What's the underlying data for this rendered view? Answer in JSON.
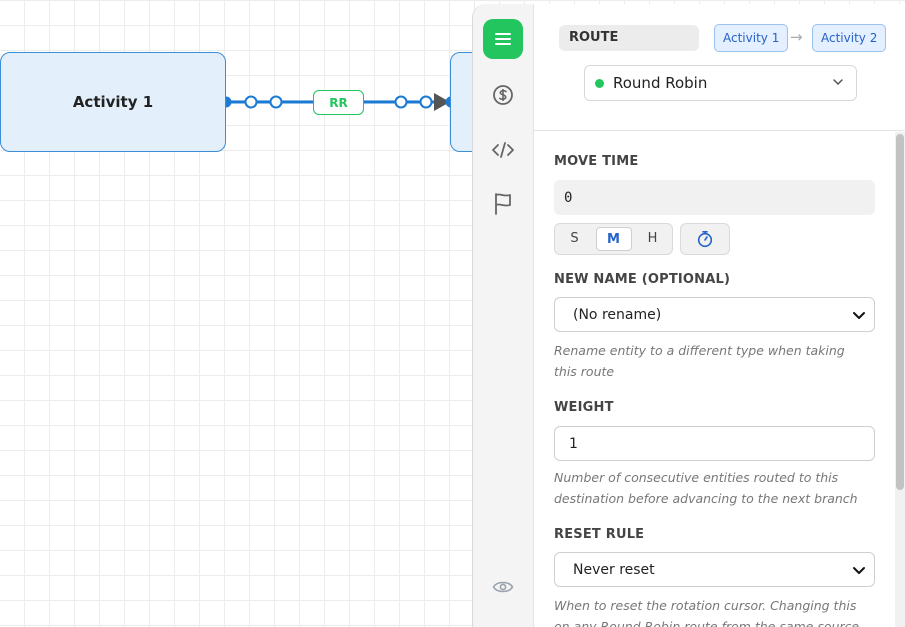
{
  "canvas": {
    "nodes": [
      {
        "label": "Activity 1"
      }
    ],
    "edge": {
      "badge": "RR"
    }
  },
  "rail": {
    "items": [
      {
        "icon": "menu-icon",
        "active": true
      },
      {
        "icon": "dollar-icon",
        "active": false
      },
      {
        "icon": "code-icon",
        "active": false
      },
      {
        "icon": "flag-icon",
        "active": false
      },
      {
        "icon": "eye-icon",
        "active": false
      }
    ]
  },
  "panel": {
    "header": {
      "tag": "ROUTE",
      "from": "Activity 1",
      "to": "Activity 2",
      "arrow": "→",
      "strategy": "Round Robin"
    },
    "move_time": {
      "label": "MOVE TIME",
      "value": "0",
      "units": [
        "S",
        "M",
        "H"
      ],
      "selected_unit": "M"
    },
    "new_name": {
      "label": "NEW NAME (OPTIONAL)",
      "value": "(No rename)",
      "hint": "Rename entity to a different type when taking this route"
    },
    "weight": {
      "label": "WEIGHT",
      "value": "1",
      "hint": "Number of consecutive entities routed to this destination before advancing to the next branch"
    },
    "reset_rule": {
      "label": "RESET RULE",
      "value": "Never reset",
      "hint": "When to reset the rotation cursor. Changing this on any Round Robin route from the same source mirrors"
    }
  },
  "colors": {
    "accent_green": "#22c55e",
    "node_border": "#3a8dd6",
    "edge": "#1a7ad4",
    "chip_text": "#2563c8"
  }
}
